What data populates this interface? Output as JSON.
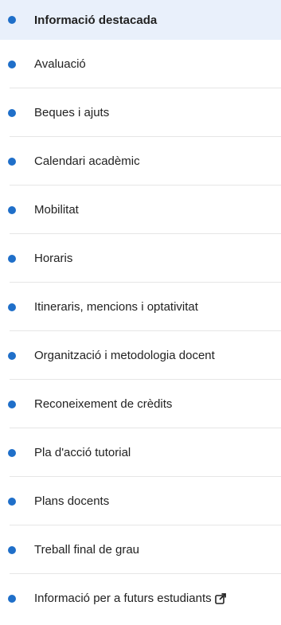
{
  "nav": {
    "items": [
      {
        "label": "Informació destacada",
        "active": true,
        "external": false
      },
      {
        "label": "Avaluació",
        "active": false,
        "external": false
      },
      {
        "label": "Beques i ajuts",
        "active": false,
        "external": false
      },
      {
        "label": "Calendari acadèmic",
        "active": false,
        "external": false
      },
      {
        "label": "Mobilitat",
        "active": false,
        "external": false
      },
      {
        "label": "Horaris",
        "active": false,
        "external": false
      },
      {
        "label": "Itineraris, mencions i optativitat",
        "active": false,
        "external": false
      },
      {
        "label": "Organització i metodologia docent",
        "active": false,
        "external": false
      },
      {
        "label": "Reconeixement de crèdits",
        "active": false,
        "external": false
      },
      {
        "label": "Pla d'acció tutorial",
        "active": false,
        "external": false
      },
      {
        "label": "Plans docents",
        "active": false,
        "external": false
      },
      {
        "label": "Treball final de grau",
        "active": false,
        "external": false
      },
      {
        "label": "Informació per a futurs estudiants",
        "active": false,
        "external": true,
        "icon": "external-link-icon"
      }
    ]
  },
  "colors": {
    "bullet": "#1f6fc9",
    "active_background": "#e9f0fb",
    "text": "#222222",
    "divider": "#e6e6e6"
  }
}
